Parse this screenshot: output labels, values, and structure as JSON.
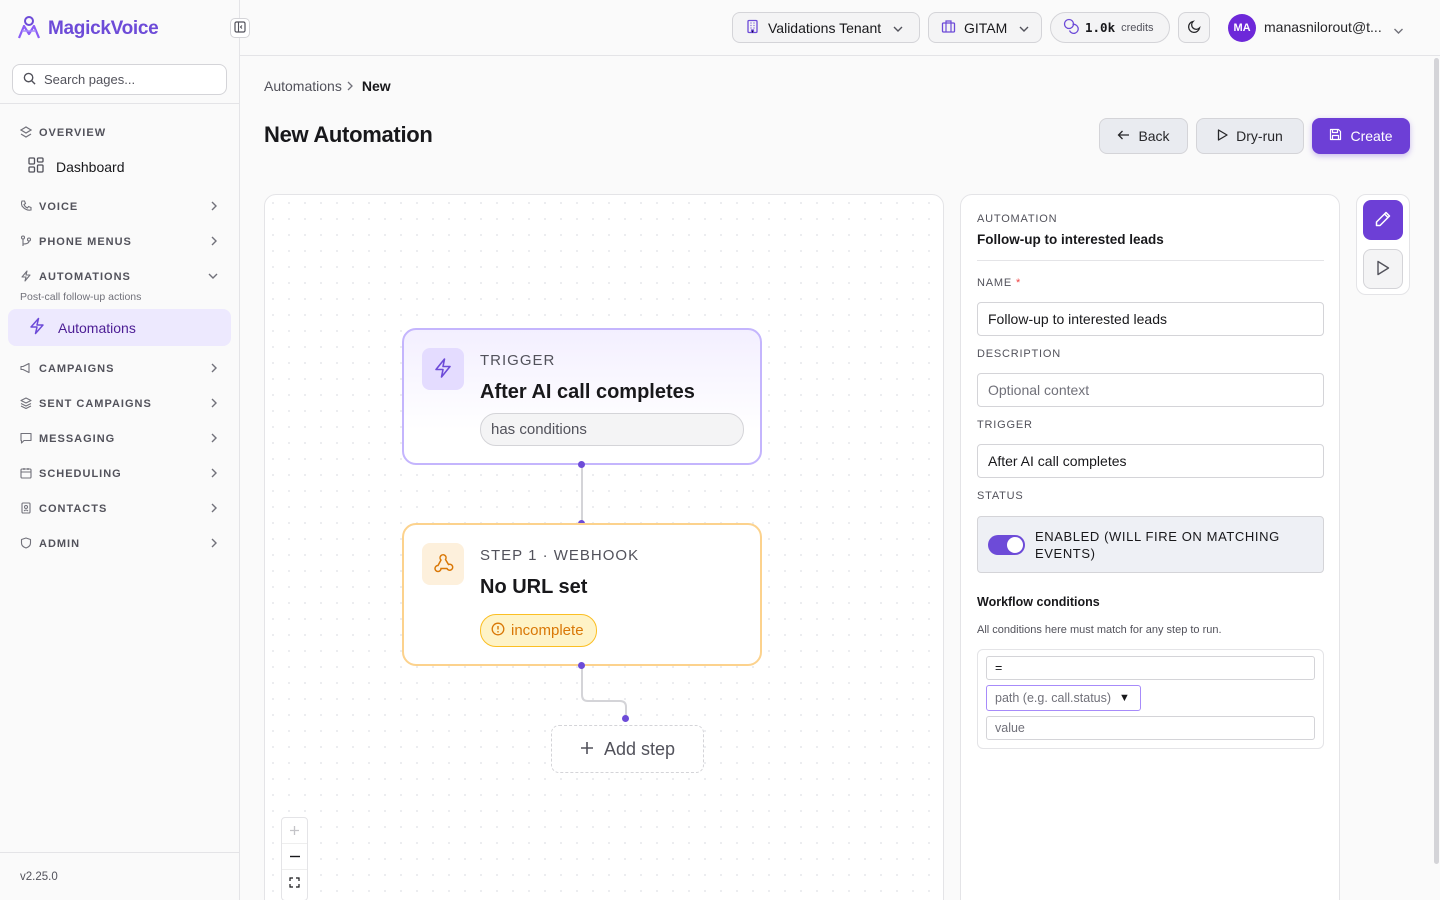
{
  "app": {
    "name": "MagickVoice",
    "version": "v2.25.0"
  },
  "search": {
    "placeholder": "Search pages..."
  },
  "sidebar": {
    "overview": "OVERVIEW",
    "dashboard": "Dashboard",
    "voice": "VOICE",
    "phone_menus": "PHONE MENUS",
    "automations_section": "AUTOMATIONS",
    "automations_sub": "Post-call follow-up actions",
    "automations_item": "Automations",
    "campaigns": "CAMPAIGNS",
    "sent_campaigns": "SENT CAMPAIGNS",
    "messaging": "MESSAGING",
    "scheduling": "SCHEDULING",
    "contacts": "CONTACTS",
    "admin": "ADMIN"
  },
  "topbar": {
    "tenant": "Validations Tenant",
    "org": "GITAM",
    "credits_value": "1.0k",
    "credits_label": "credits",
    "avatar_initials": "MA",
    "user_name": "manasnilorout@t..."
  },
  "breadcrumb": {
    "parent": "Automations",
    "current": "New"
  },
  "page": {
    "title": "New Automation"
  },
  "actions": {
    "back": "Back",
    "dry_run": "Dry-run",
    "create": "Create"
  },
  "flow": {
    "trigger": {
      "kicker": "TRIGGER",
      "title": "After AI call completes",
      "chip": "has conditions"
    },
    "step1": {
      "kicker": "STEP 1 · WEBHOOK",
      "title": "No URL set",
      "chip": "incomplete"
    },
    "add_step": "Add step"
  },
  "panel": {
    "kicker": "AUTOMATION",
    "title": "Follow-up to interested leads",
    "name_label": "NAME",
    "name_value": "Follow-up to interested leads",
    "description_label": "DESCRIPTION",
    "description_placeholder": "Optional context",
    "trigger_label": "TRIGGER",
    "trigger_value": "After AI call completes",
    "status_label": "STATUS",
    "status_text": "ENABLED (WILL FIRE ON MATCHING EVENTS)",
    "status_enabled": true,
    "workflow_title": "Workflow conditions",
    "workflow_sub": "All conditions here must match for any step to run.",
    "condition": {
      "operator": "=",
      "path_placeholder": "path (e.g. call.status)",
      "value_placeholder": "value"
    }
  },
  "colors": {
    "accent": "#6d3fd6",
    "trigger_border": "#c4b5fd",
    "step_border": "#fcd28d",
    "warning": "#d97706"
  },
  "icons": [
    "logo-icon",
    "sidebar-collapse-icon",
    "search-icon",
    "grid-icon",
    "phone-icon",
    "branch-icon",
    "bolt-icon",
    "megaphone-icon",
    "layers-icon",
    "chat-icon",
    "calendar-icon",
    "contacts-icon",
    "shield-icon",
    "building-icon",
    "briefcase-icon",
    "coins-icon",
    "moon-icon",
    "arrow-left-icon",
    "play-icon",
    "save-icon",
    "webhook-icon",
    "alert-circle-icon",
    "plus-icon",
    "pencil-icon"
  ]
}
